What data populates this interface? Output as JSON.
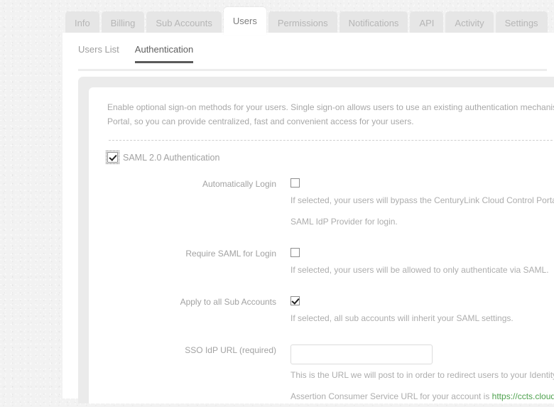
{
  "tabs": [
    {
      "label": "Info",
      "active": false
    },
    {
      "label": "Billing",
      "active": false
    },
    {
      "label": "Sub Accounts",
      "active": false
    },
    {
      "label": "Users",
      "active": true
    },
    {
      "label": "Permissions",
      "active": false
    },
    {
      "label": "Notifications",
      "active": false
    },
    {
      "label": "API",
      "active": false
    },
    {
      "label": "Activity",
      "active": false
    },
    {
      "label": "Settings",
      "active": false
    }
  ],
  "subnav": [
    {
      "label": "Users List",
      "active": false
    },
    {
      "label": "Authentication",
      "active": true
    }
  ],
  "intro": {
    "line1": "Enable optional sign-on methods for your users. Single sign-on allows users to use an existing authentication mechanism with the Ce",
    "line2": "Portal, so you can provide centralized, fast and convenient access for your users."
  },
  "saml_master": {
    "label": "SAML 2.0 Authentication",
    "checked": true,
    "focused": true
  },
  "fields": [
    {
      "label": "Automatically Login",
      "checked": false,
      "help_lines": [
        "If selected, your users will bypass the CenturyLink Cloud Control Portal Login page and be automa",
        "SAML IdP Provider for login."
      ]
    },
    {
      "label": "Require SAML for Login",
      "checked": false,
      "help_lines": [
        "If selected, your users will be allowed to only authenticate via SAML."
      ]
    },
    {
      "label": "Apply to all Sub Accounts",
      "checked": true,
      "help_lines": [
        "If selected, all sub accounts will inherit your SAML settings."
      ]
    }
  ],
  "sso_field": {
    "label": "SSO IdP URL (required)",
    "value": "",
    "placeholder": "",
    "help_line": "This is the URL we will post to in order to redirect users to your Identity Provider for Single Sign-on",
    "acs_prefix": "Assertion Consumer Service URL for your account is ",
    "acs_url": "https://ccts.cloudportal.io/SAMLAuth/Post"
  },
  "colors": {
    "link_green": "#4ea24e",
    "active_underline": "#5a5a5a",
    "page_bg": "#f2f2f2"
  }
}
